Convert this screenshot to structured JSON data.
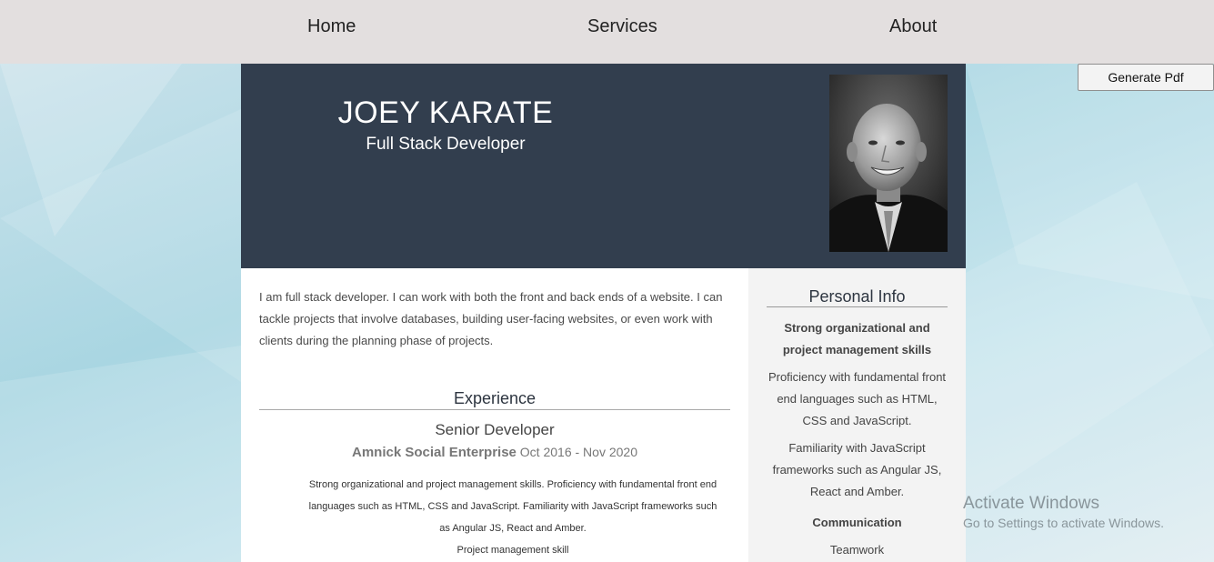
{
  "nav": {
    "home": "Home",
    "services": "Services",
    "about": "About"
  },
  "actions": {
    "generate_pdf": "Generate Pdf"
  },
  "profile": {
    "name": "JOEY KARATE",
    "title": "Full Stack Developer",
    "about": "I am full stack developer. I can work with both the front and back ends of a website. I can tackle projects that involve databases, building user-facing websites, or even work with clients during the planning phase of projects."
  },
  "experience": {
    "heading": "Experience",
    "job_title": "Senior Developer",
    "company": "Amnick Social Enterprise",
    "dates": "Oct 2016 - Nov 2020",
    "description": "Strong organizational and project management skills. Proficiency with fundamental front end languages such as HTML, CSS and JavaScript. Familiarity with JavaScript frameworks such as Angular JS, React and Amber.",
    "skill": "Project management skill"
  },
  "personal_info": {
    "heading": "Personal Info",
    "item1": "Strong organizational and project management skills",
    "item2": "Proficiency with fundamental front end languages such as HTML, CSS and JavaScript.",
    "item3": "Familiarity with JavaScript frameworks such as Angular JS, React and Amber.",
    "item4": "Communication",
    "item5": "Teamwork"
  },
  "watermark": {
    "title": "Activate Windows",
    "subtitle": "Go to Settings to activate Windows."
  },
  "colors": {
    "nav_bg": "#e3dfdf",
    "header_bg": "#323e4e",
    "sidebar_bg": "#f3f3f3"
  },
  "icons": {
    "photo": "profile-photo"
  }
}
